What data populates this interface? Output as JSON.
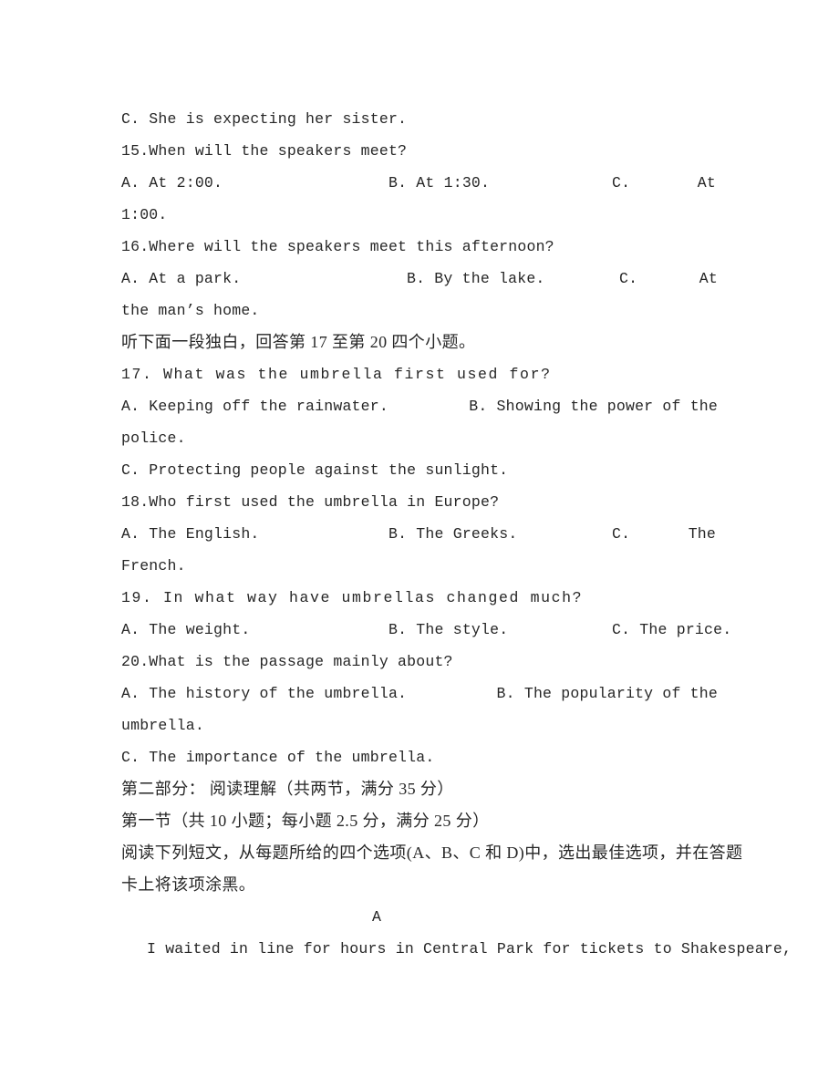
{
  "document": {
    "type": "english-exam-paper",
    "page_background": "#ffffff",
    "text_color": "#262626"
  },
  "listening_section": {
    "question_14_option_c": "C. She is expecting her sister.",
    "questions": [
      {
        "number": "15.",
        "stem": "15.When will the speakers meet?",
        "options_line": {
          "a": "A. At 2:00.",
          "b": "B. At 1:30.",
          "c_label": "C.",
          "c_text": "At"
        },
        "wrapped": "1:00."
      },
      {
        "number": "16.",
        "stem": "16.Where will the speakers meet this afternoon?",
        "options_line": {
          "a": "A. At a park.",
          "b": "B. By the lake.",
          "c_label": "C.",
          "c_text": "At"
        },
        "wrapped": "the man’s home."
      }
    ],
    "monologue_instruction": "听下面一段独白，回答第 17 至第 20 四个小题。",
    "monologue_questions": [
      {
        "number": "17.",
        "stem": "17. What was the umbrella first used for?",
        "option_a": "A. Keeping off the rainwater.",
        "option_b": "B. Showing the power of the",
        "wrapped": "police.",
        "option_c": "C. Protecting people against the sunlight."
      },
      {
        "number": "18.",
        "stem": "18.Who first used the umbrella in Europe?",
        "options_line": {
          "a": "A. The English.",
          "b": "B. The Greeks.",
          "c_label": "C.",
          "c_text": "The"
        },
        "wrapped": "French."
      },
      {
        "number": "19.",
        "stem": "19. In what way have umbrellas changed much?",
        "options_line": {
          "a": "A. The weight.",
          "b": "B. The style.",
          "c": "C. The price."
        }
      },
      {
        "number": "20.",
        "stem": "20.What is the passage mainly about?",
        "option_a": "A. The history of the umbrella.",
        "option_b": "B. The popularity of the",
        "wrapped": "umbrella.",
        "option_c": "C. The importance of the umbrella."
      }
    ]
  },
  "reading_section": {
    "part_heading": "第二部分：  阅读理解（共两节，满分 35 分）",
    "subsection_heading": "第一节（共 10 小题；每小题 2.5 分，满分 25 分）",
    "instruction_line_1": "阅读下列短文，从每题所给的四个选项(A、B、C 和 D)中，选出最佳选项，并在答题",
    "instruction_line_2": "卡上将该项涂黑。",
    "passage_label": "A",
    "passage_first_line": "I waited in line for hours in Central Park for tickets to Shakespeare,"
  }
}
